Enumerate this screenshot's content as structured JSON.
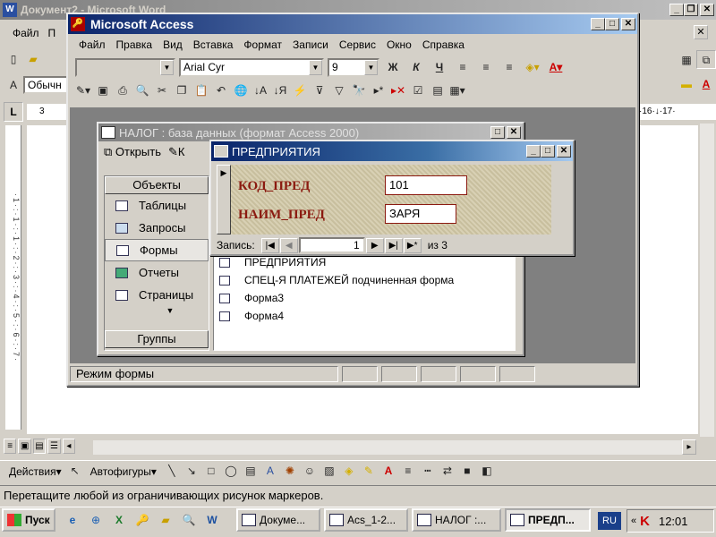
{
  "word": {
    "title": "Документ2 - Microsoft Word",
    "menu_file": "Файл",
    "menu_cut": "П",
    "style": "Обычн",
    "ruler_left": "3",
    "ruler_right": "·16·↓·17·",
    "status": "Перетащите любой из ограничивающих рисунок маркеров.",
    "draw_actions": "Действия",
    "draw_autoshapes": "Автофигуры"
  },
  "access": {
    "title": "Microsoft Access",
    "menu": [
      "Файл",
      "Правка",
      "Вид",
      "Вставка",
      "Формат",
      "Записи",
      "Сервис",
      "Окно",
      "Справка"
    ],
    "font": "Arial Cyr",
    "size": "9",
    "status": "Режим формы"
  },
  "db": {
    "title": "НАЛОГ : база данных (формат Access 2000)",
    "open": "Открыть",
    "k": "К",
    "objects_header": "Объекты",
    "groups": "Группы",
    "objects": [
      {
        "icon": "table-icon",
        "label": "Таблицы"
      },
      {
        "icon": "query-icon",
        "label": "Запросы"
      },
      {
        "icon": "form-icon",
        "label": "Формы"
      },
      {
        "icon": "report-icon",
        "label": "Отчеты"
      },
      {
        "icon": "page-icon",
        "label": "Страницы"
      }
    ],
    "forms": [
      "ПРЕДПРИЯТИЯ",
      "СПЕЦ-Я ПЛАТЕЖЕЙ подчиненная форма",
      "Форма3",
      "Форма4"
    ]
  },
  "form": {
    "title": "ПРЕДПРИЯТИЯ",
    "field1_label": "КОД_ПРЕД",
    "field1_value": "101",
    "field2_label": "НАИМ_ПРЕД",
    "field2_value": "ЗАРЯ",
    "record_label": "Запись:",
    "record_current": "1",
    "record_of": "из  3"
  },
  "taskbar": {
    "start": "Пуск",
    "tasks": [
      "Докуме...",
      "Acs_1-2...",
      "НАЛОГ :...",
      "ПРЕДП..."
    ],
    "lang": "RU",
    "clock": "12:01"
  },
  "colors": {
    "title_active": "#0a246a",
    "form_label": "#8b1a10",
    "taskbar": "#d4d0c8"
  }
}
